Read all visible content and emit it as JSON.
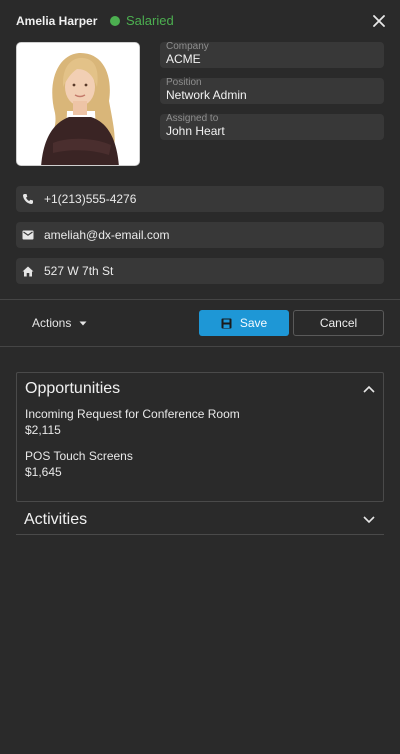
{
  "header": {
    "name": "Amelia Harper",
    "status": "Salaried",
    "status_color": "#4caf50",
    "close_icon": "close-icon"
  },
  "profile": {
    "photo": "employee-photo",
    "fields": [
      {
        "label": "Company",
        "value": "ACME"
      },
      {
        "label": "Position",
        "value": "Network Admin"
      },
      {
        "label": "Assigned to",
        "value": "John Heart"
      }
    ]
  },
  "contacts": [
    {
      "icon": "phone-icon",
      "value": "+1(213)555-4276"
    },
    {
      "icon": "email-icon",
      "value": "ameliah@dx-email.com"
    },
    {
      "icon": "home-icon",
      "value": "527 W 7th St"
    }
  ],
  "toolbar": {
    "actions_label": "Actions",
    "save_label": "Save",
    "cancel_label": "Cancel",
    "accent": "#1e97d6"
  },
  "opportunities": {
    "title": "Opportunities",
    "expanded": true,
    "items": [
      {
        "name": "Incoming Request for Conference Room",
        "amount": "$2,115"
      },
      {
        "name": "POS Touch Screens",
        "amount": "$1,645"
      }
    ]
  },
  "activities": {
    "title": "Activities",
    "expanded": false
  }
}
